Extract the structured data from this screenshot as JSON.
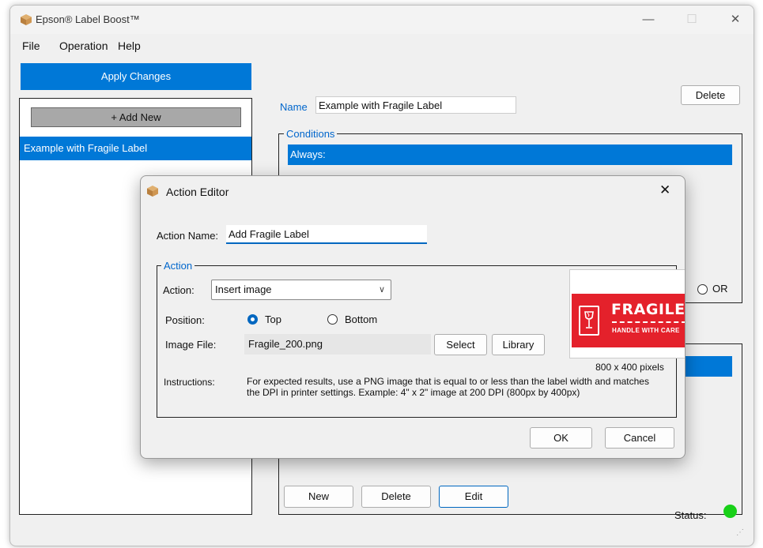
{
  "app": {
    "title": "Epson® Label Boost™"
  },
  "window_controls": {
    "minimize": "—",
    "maximize": "☐",
    "close": "✕"
  },
  "menu": [
    "File",
    "Operation",
    "Help"
  ],
  "sidebar": {
    "apply_label": "Apply Changes",
    "add_new_label": "+ Add New",
    "items": [
      "Example with Fragile Label"
    ]
  },
  "rule": {
    "name_label": "Name",
    "name_value": "Example with Fragile Label",
    "delete_label": "Delete",
    "conditions_title": "Conditions",
    "conditions_selected": "Always:",
    "or_label": "OR",
    "buttons": {
      "new": "New",
      "delete": "Delete",
      "edit": "Edit"
    }
  },
  "status": {
    "label": "Status:",
    "color": "#18d018"
  },
  "dialog": {
    "title": "Action Editor",
    "close": "✕",
    "action_name_label": "Action Name:",
    "action_name_value": "Add Fragile Label",
    "group_title": "Action",
    "action_label": "Action:",
    "action_value": "Insert image",
    "position_label": "Position:",
    "position_options": [
      "Top",
      "Bottom"
    ],
    "position_selected": "Top",
    "image_file_label": "Image File:",
    "image_file_value": "Fragile_200.png",
    "select_label": "Select",
    "library_label": "Library",
    "preview_text": "FRAGILE",
    "preview_subtext": "HANDLE WITH CARE",
    "preview_size": "800 x 400 pixels",
    "instructions_label": "Instructions:",
    "instructions_text": "For expected results, use a PNG image that is equal to or less than the label width and matches the DPI in printer settings. Example: 4\" x 2\" image at 200 DPI (800px by 400px)",
    "ok_label": "OK",
    "cancel_label": "Cancel"
  },
  "colors": {
    "accent": "#0078d7",
    "fragile_red": "#e4212b"
  }
}
